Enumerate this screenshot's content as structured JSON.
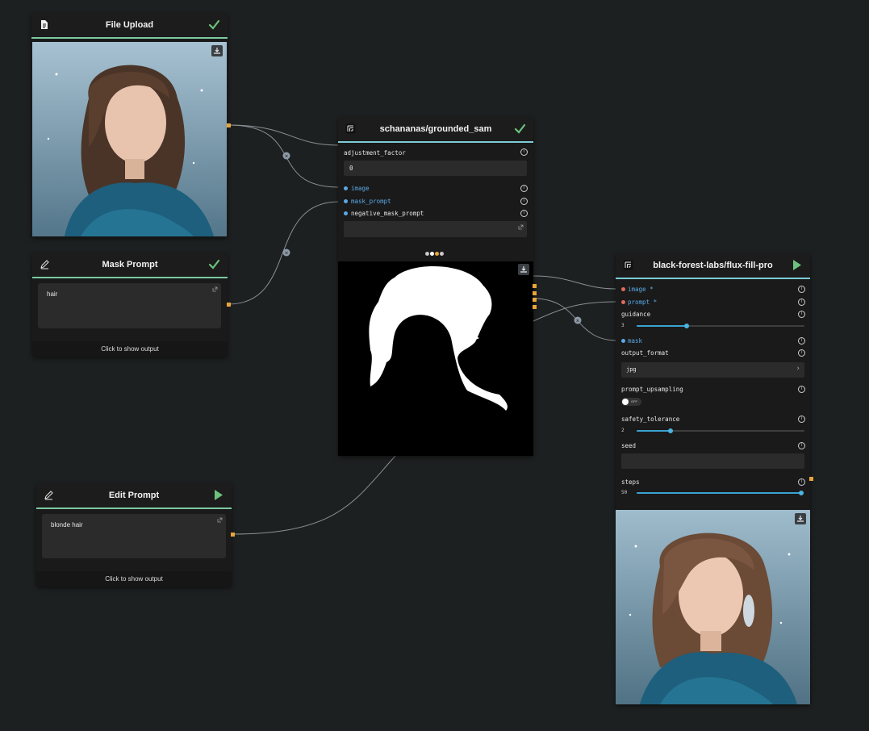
{
  "nodes": {
    "file_upload": {
      "title": "File Upload",
      "icon": "file-icon",
      "status": "check-icon"
    },
    "mask_prompt": {
      "title": "Mask Prompt",
      "icon": "pencil-icon",
      "status": "check-icon",
      "text": "hair",
      "show_output": "Click to show output"
    },
    "edit_prompt": {
      "title": "Edit Prompt",
      "icon": "pencil-icon",
      "status": "play-icon",
      "text": "blonde hair",
      "show_output": "Click to show output"
    },
    "grounded_sam": {
      "title": "schananas/grounded_sam",
      "status": "check-icon",
      "params": {
        "adjustment_factor": {
          "label": "adjustment_factor",
          "value": "0"
        },
        "image": {
          "label": "image"
        },
        "mask_prompt": {
          "label": "mask_prompt"
        },
        "negative_mask_prompt": {
          "label": "negative_mask_prompt"
        }
      },
      "output_colors": [
        "#c8c8c8",
        "#ffffff",
        "#e8a53a",
        "#c8c8c8"
      ]
    },
    "flux_fill": {
      "title": "black-forest-labs/flux-fill-pro",
      "status": "play-icon",
      "params": {
        "image": {
          "label": "image *"
        },
        "prompt": {
          "label": "prompt *"
        },
        "guidance": {
          "label": "guidance",
          "value": "3",
          "fraction": 0.3
        },
        "mask": {
          "label": "mask"
        },
        "output_format": {
          "label": "output_format",
          "value": "jpg"
        },
        "prompt_upsampling": {
          "label": "prompt_upsampling",
          "toggle": "OFF"
        },
        "safety_tolerance": {
          "label": "safety_tolerance",
          "value": "2",
          "fraction": 0.2
        },
        "seed": {
          "label": "seed"
        },
        "steps": {
          "label": "steps",
          "value": "50",
          "fraction": 1.0
        }
      }
    }
  },
  "colors": {
    "accent_green": "#7bc9a0",
    "accent_blue": "#7ccbd6",
    "port_orange": "#e8a53a",
    "input_blue": "#5aa9e6",
    "required_red": "#e06c5a"
  }
}
